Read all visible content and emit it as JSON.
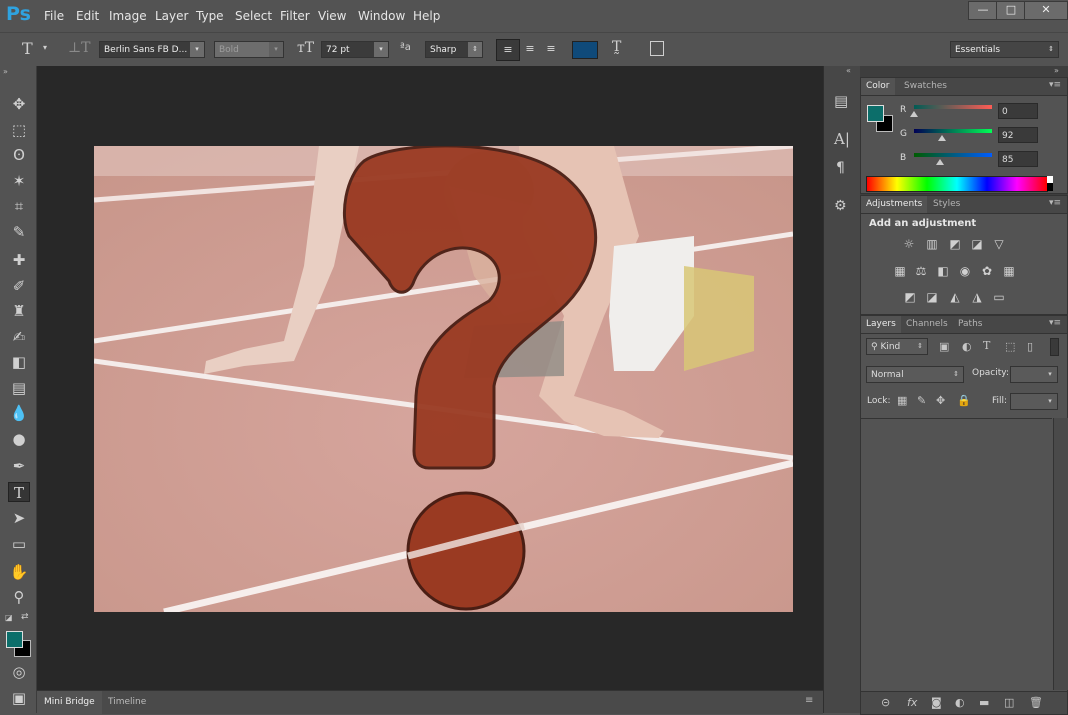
{
  "app": {
    "logo": "Ps"
  },
  "menu": [
    "File",
    "Edit",
    "Image",
    "Layer",
    "Type",
    "Select",
    "Filter",
    "View",
    "Window",
    "Help"
  ],
  "window_controls": {
    "minimize": "—",
    "maximize": "□",
    "close": "✕"
  },
  "options_bar": {
    "font_family": "Berlin Sans FB D...",
    "font_style": "Bold",
    "font_size": "72 pt",
    "antialias_icon": "ªa",
    "antialias": "Sharp",
    "text_color": "#0f4a7a",
    "workspace": "Essentials"
  },
  "toolbox": {
    "tools": [
      "move-tool",
      "marquee-tool",
      "lasso-tool",
      "magic-wand-tool",
      "crop-tool",
      "eyedropper-tool",
      "healing-brush-tool",
      "brush-tool",
      "clone-stamp-tool",
      "history-brush-tool",
      "eraser-tool",
      "gradient-tool",
      "blur-tool",
      "dodge-tool",
      "pen-tool",
      "type-tool",
      "path-selection-tool",
      "rectangle-tool",
      "hand-tool",
      "zoom-tool"
    ],
    "foreground_color": "#0c6e6a",
    "background_color": "#000000"
  },
  "bottom_tabs": [
    "Mini Bridge",
    "Timeline"
  ],
  "color_panel": {
    "tabs": [
      "Color",
      "Swatches"
    ],
    "r_label": "R",
    "r_value": "0",
    "g_label": "G",
    "g_value": "92",
    "b_label": "B",
    "b_value": "85"
  },
  "adjustments_panel": {
    "tabs": [
      "Adjustments",
      "Styles"
    ],
    "heading": "Add an adjustment"
  },
  "layers_panel": {
    "tabs": [
      "Layers",
      "Channels",
      "Paths"
    ],
    "filter_kind": "Kind",
    "blend_mode": "Normal",
    "opacity_label": "Opacity:",
    "lock_label": "Lock:",
    "fill_label": "Fill:"
  }
}
